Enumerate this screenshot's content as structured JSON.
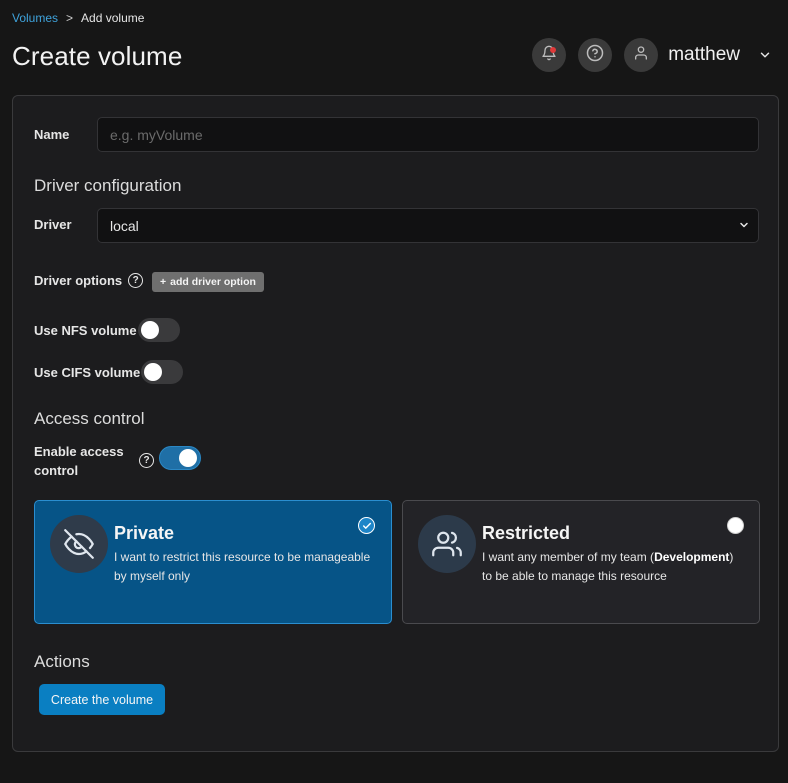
{
  "breadcrumb": {
    "link": "Volumes",
    "separator": ">",
    "current": "Add volume"
  },
  "header": {
    "title": "Create volume",
    "user_name": "matthew",
    "icons": {
      "notifications": "bell-icon",
      "help": "help-circle-icon",
      "avatar": "user-icon",
      "menu": "chevron-down-icon"
    },
    "notification_dot_color": "#e03a3a"
  },
  "form": {
    "name": {
      "label": "Name",
      "placeholder": "e.g. myVolume",
      "value": ""
    },
    "driver_section": "Driver configuration",
    "driver": {
      "label": "Driver",
      "selected": "local"
    },
    "driver_options": {
      "label": "Driver options",
      "add_button": "add driver option",
      "add_icon": "+"
    },
    "nfs": {
      "label": "Use NFS volume",
      "enabled": false
    },
    "cifs": {
      "label": "Use CIFS volume",
      "enabled": false
    },
    "access_section": "Access control",
    "access_toggle": {
      "label_line1": "Enable access",
      "label_line2": "control",
      "enabled": true
    },
    "access_cards": [
      {
        "title": "Private",
        "description": "I want to restrict this resource to be manageable by myself only",
        "selected": true,
        "icon": "eye-off-icon"
      },
      {
        "title": "Restricted",
        "description_before": "I want any member of my team (",
        "team": "Development",
        "description_after": ") to be able to manage this resource",
        "selected": false,
        "icon": "users-icon"
      }
    ],
    "actions_section": "Actions",
    "submit_label": "Create the volume"
  },
  "colors": {
    "accent": "#0a7fc2",
    "link": "#3fa3dc",
    "selected_card": "#065487",
    "background": "#161616",
    "panel": "#1c1c1e"
  }
}
